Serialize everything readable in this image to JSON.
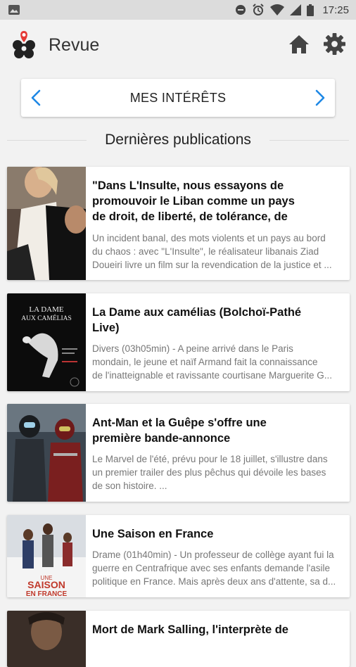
{
  "status_bar": {
    "time": "17:25",
    "icons": [
      "image-icon",
      "dnd-icon",
      "alarm-icon",
      "wifi-icon",
      "signal-icon",
      "battery-icon"
    ]
  },
  "app_bar": {
    "title": "Revue",
    "icons": [
      "logo-icon",
      "home-icon",
      "settings-icon"
    ]
  },
  "selector": {
    "label": "MES INTÉRÊTS"
  },
  "section": {
    "title": "Dernières publications"
  },
  "colors": {
    "accent": "#1e88e5",
    "logo_red": "#e53935"
  },
  "articles": [
    {
      "title_lines": [
        "\"Dans L'Insulte, nous essayons de",
        "promouvoir le Liban comme un pays",
        "de droit, de liberté, de tolérance, de"
      ],
      "desc_lines": [
        "Un incident banal, des mots violents et un pays au bord",
        "du chaos : avec \"L'Insulte\", le réalisateur libanais Ziad",
        "Doueiri livre un film sur la revendication de la justice et ..."
      ]
    },
    {
      "title_lines": [
        "La Dame aux camélias (Bolchoï-Pathé",
        "Live)"
      ],
      "desc_lines": [
        "Divers (03h05min) - A peine arrivé dans le Paris",
        "mondain, le jeune et naïf Armand fait la connaissance",
        "de l'inatteignable et ravissante courtisane Marguerite G..."
      ],
      "poster_text": [
        "LA DAME",
        "AUX CAMÉLIAS"
      ]
    },
    {
      "title_lines": [
        "Ant-Man et la Guêpe s'offre une",
        "première bande-annonce"
      ],
      "desc_lines": [
        "Le Marvel de l'été, prévu pour le 18 juillet, s'illustre dans",
        "un premier trailer des plus pêchus qui dévoile les bases",
        "de son histoire. ..."
      ]
    },
    {
      "title_lines": [
        "Une Saison en France"
      ],
      "desc_lines": [
        "Drame (01h40min) - Un professeur de collège ayant fui la",
        "guerre en Centrafrique avec ses enfants demande l'asile",
        "politique en France. Mais après deux ans d'attente, sa d..."
      ],
      "poster_text": [
        "UNE",
        "SAISON",
        "EN FRANCE"
      ]
    },
    {
      "title_lines": [
        "Mort de Mark Salling, l'interprète de"
      ],
      "desc_lines": []
    }
  ]
}
